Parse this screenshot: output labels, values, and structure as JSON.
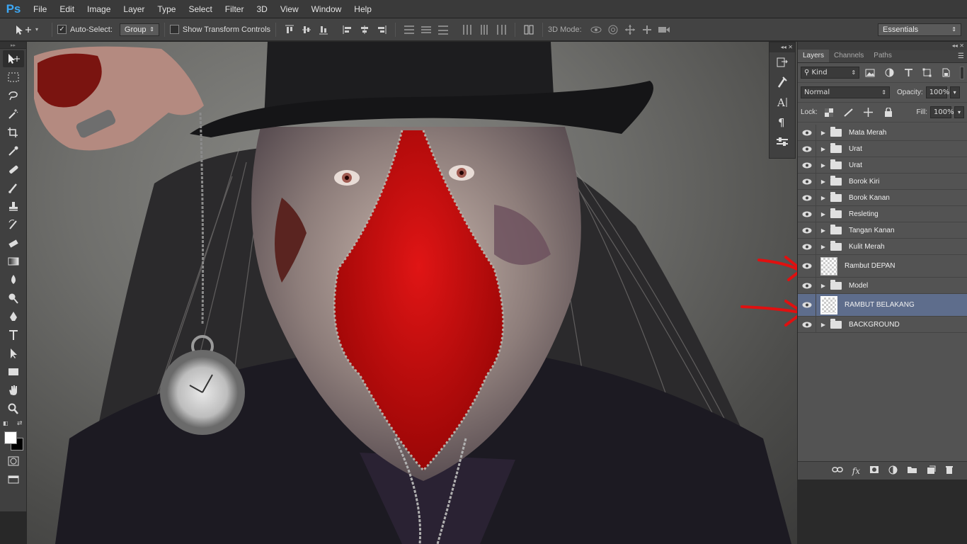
{
  "app": {
    "logo": "Ps"
  },
  "menu": [
    "File",
    "Edit",
    "Image",
    "Layer",
    "Type",
    "Select",
    "Filter",
    "3D",
    "View",
    "Window",
    "Help"
  ],
  "options": {
    "auto_select_label": "Auto-Select:",
    "auto_select_checked": "✓",
    "auto_select_value": "Group",
    "show_transform_label": "Show Transform Controls",
    "mode_3d_label": "3D Mode:",
    "workspace": "Essentials"
  },
  "layers_panel": {
    "tabs": [
      "Layers",
      "Channels",
      "Paths"
    ],
    "filter_kind": "Kind",
    "blend_mode": "Normal",
    "opacity_label": "Opacity:",
    "opacity_value": "100%",
    "lock_label": "Lock:",
    "fill_label": "Fill:",
    "fill_value": "100%",
    "layers": [
      {
        "name": "Mata Merah",
        "type": "group"
      },
      {
        "name": "Urat",
        "type": "group"
      },
      {
        "name": "Urat",
        "type": "group"
      },
      {
        "name": "Borok Kiri",
        "type": "group"
      },
      {
        "name": "Borok Kanan",
        "type": "group"
      },
      {
        "name": "Resleting",
        "type": "group"
      },
      {
        "name": "Tangan Kanan",
        "type": "group"
      },
      {
        "name": "Kulit Merah",
        "type": "group"
      },
      {
        "name": "Rambut DEPAN",
        "type": "layer"
      },
      {
        "name": "Model",
        "type": "group"
      },
      {
        "name": "RAMBUT BELAKANG",
        "type": "layer",
        "selected": true
      },
      {
        "name": "BACKGROUND",
        "type": "group"
      }
    ]
  },
  "colors": {
    "accent_blue": "#3da8f5",
    "selected_layer": "#5e6d8c",
    "annotation_red": "#e01010",
    "face_red": "#c4100c"
  }
}
